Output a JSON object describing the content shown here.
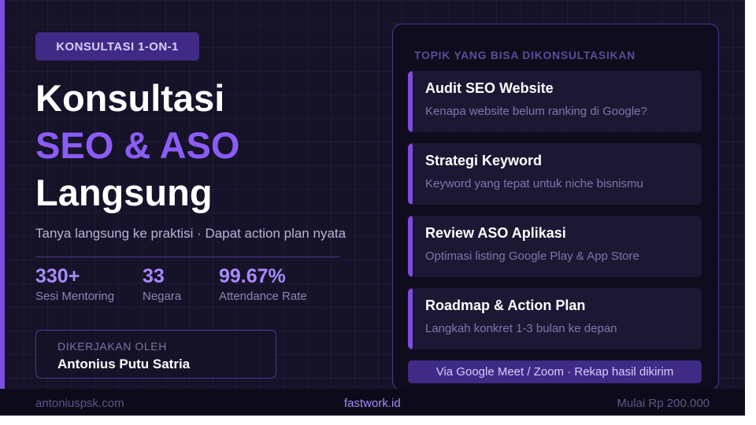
{
  "badge": "KONSULTASI 1-ON-1",
  "headline": {
    "line1": "Konsultasi",
    "line2": "SEO & ASO",
    "line3": "Langsung"
  },
  "tagline": "Tanya langsung ke praktisi · Dapat action plan nyata",
  "stats": [
    {
      "value": "330+",
      "label": "Sesi Mentoring"
    },
    {
      "value": "33",
      "label": "Negara"
    },
    {
      "value": "99.67%",
      "label": "Attendance Rate"
    }
  ],
  "author": {
    "caption": "DIKERJAKAN OLEH",
    "name": "Antonius Putu Satria"
  },
  "panel": {
    "title": "TOPIK YANG BISA DIKONSULTASIKAN",
    "topics": [
      {
        "title": "Audit SEO Website",
        "subtitle": "Kenapa website belum ranking di Google?"
      },
      {
        "title": "Strategi Keyword",
        "subtitle": "Keyword yang tepat untuk niche bisnismu"
      },
      {
        "title": "Review ASO Aplikasi",
        "subtitle": "Optimasi listing Google Play & App Store"
      },
      {
        "title": "Roadmap & Action Plan",
        "subtitle": "Langkah konkret 1-3 bulan ke depan"
      }
    ],
    "footer": "Via Google Meet / Zoom · Rekap hasil dikirim"
  },
  "footer": {
    "left": "antoniuspsk.com",
    "center": "fastwork.id",
    "right": "Mulai Rp 200.000"
  },
  "colors": {
    "background": "#161228",
    "accent": "#7c4ddf",
    "highlight": "#8b5cf6",
    "stat_value": "#a78bfa",
    "badge_bg": "#3f2a85"
  }
}
